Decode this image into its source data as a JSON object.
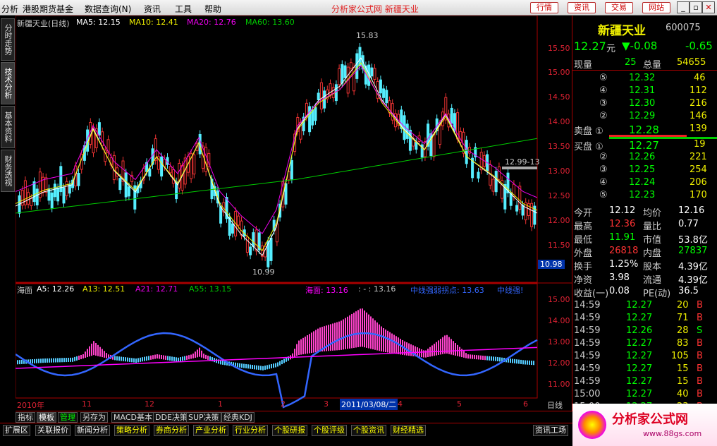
{
  "menu": {
    "items": [
      "分析",
      "港股期货基金",
      "数据查询(N)",
      "资讯",
      "工具",
      "帮助"
    ],
    "center": "分析家公式网 新疆天业",
    "buttons": [
      "行情",
      "资讯",
      "交易",
      "网站"
    ]
  },
  "sidetabs": [
    "分时走势",
    "技术分析",
    "基本资料",
    "财务透视"
  ],
  "main_header": {
    "title": "新疆天业(日线)",
    "ma5": "MA5: 12.15",
    "ma10": "MA10: 12.41",
    "ma20": "MA20: 12.76",
    "ma60": "MA60: 13.60"
  },
  "main_annot": {
    "high": "15.83",
    "low": "10.99",
    "cur": "12.99-13",
    "cursor_price": "10.98"
  },
  "main_yaxis": [
    "15.50",
    "15.00",
    "14.50",
    "14.00",
    "13.50",
    "13.00",
    "12.50",
    "12.00",
    "11.50"
  ],
  "sub_header": {
    "name": "海面",
    "a5": "A5: 12.26",
    "a13": "A13: 12.51",
    "a21": "A21: 12.71",
    "a55": "A55: 13.15",
    "hm": "海面: 13.16",
    "dots": ": - : 13.16",
    "mid": "中线强弱拐点: 13.63",
    "strong": "中线强!"
  },
  "sub_yaxis": [
    "15.00",
    "14.00",
    "13.00",
    "12.00",
    "11.00"
  ],
  "xaxis": {
    "labels": [
      "2010年",
      "11",
      "12",
      "1",
      "2",
      "3",
      "2011/03/08/二",
      "4",
      "5",
      "6"
    ],
    "unit": "日线"
  },
  "quote": {
    "name": "新疆天业",
    "code": "600075",
    "price": "12.27",
    "unit": "元",
    "change": "▼-0.08",
    "pct": "-0.65",
    "xianpan": "现量",
    "xianpan_v": "25",
    "zongliang": "总量",
    "zongliang_v": "54655",
    "sell": [
      {
        "n": "⑤",
        "p": "12.32",
        "v": "46"
      },
      {
        "n": "④",
        "p": "12.31",
        "v": "112"
      },
      {
        "n": "③",
        "p": "12.30",
        "v": "216"
      },
      {
        "n": "②",
        "p": "12.29",
        "v": "146"
      },
      {
        "n": "卖盘 ①",
        "p": "12.28",
        "v": "139"
      }
    ],
    "buy": [
      {
        "n": "买盘 ①",
        "p": "12.27",
        "v": "19"
      },
      {
        "n": "②",
        "p": "12.26",
        "v": "221"
      },
      {
        "n": "③",
        "p": "12.25",
        "v": "254"
      },
      {
        "n": "④",
        "p": "12.24",
        "v": "206"
      },
      {
        "n": "⑤",
        "p": "12.23",
        "v": "170"
      }
    ],
    "stats": [
      [
        "今开",
        "12.12",
        "均价",
        "12.16"
      ],
      [
        "最高",
        "12.36",
        "量比",
        "0.77"
      ],
      [
        "最低",
        "11.91",
        "市值",
        "53.8亿"
      ],
      [
        "外盘",
        "26818",
        "内盘",
        "27837"
      ],
      [
        "换手",
        "1.25%",
        "股本",
        "4.39亿"
      ],
      [
        "净资",
        "3.98",
        "流通",
        "4.39亿"
      ],
      [
        "收益(一)",
        "0.08",
        "PE(动)",
        "36.5"
      ]
    ],
    "ticks": [
      [
        "14:59",
        "12.27",
        "20",
        "B"
      ],
      [
        "14:59",
        "12.27",
        "71",
        "B"
      ],
      [
        "14:59",
        "12.26",
        "28",
        "S"
      ],
      [
        "14:59",
        "12.27",
        "83",
        "B"
      ],
      [
        "14:59",
        "12.27",
        "105",
        "B"
      ],
      [
        "14:59",
        "12.27",
        "15",
        "B"
      ],
      [
        "14:59",
        "12.27",
        "15",
        "B"
      ],
      [
        "15:00",
        "12.27",
        "40",
        "B"
      ],
      [
        "15:00",
        "12.27",
        "23",
        "B"
      ]
    ]
  },
  "tabs1": [
    "指标",
    "模板",
    "管理",
    "另存为",
    "MACD基本",
    "DDE决策",
    "SUP决策",
    "经典KDJ"
  ],
  "tabs2": [
    "扩展区",
    "关联报价",
    "新闻分析",
    "策略分析",
    "券商分析",
    "产业分析",
    "行业分析",
    "个股研报",
    "个股评级",
    "个股资讯",
    "财经精选"
  ],
  "tab2_right": "资讯工场",
  "logo_text": "分析家公式网",
  "logo_url": "www.88gs.com"
}
